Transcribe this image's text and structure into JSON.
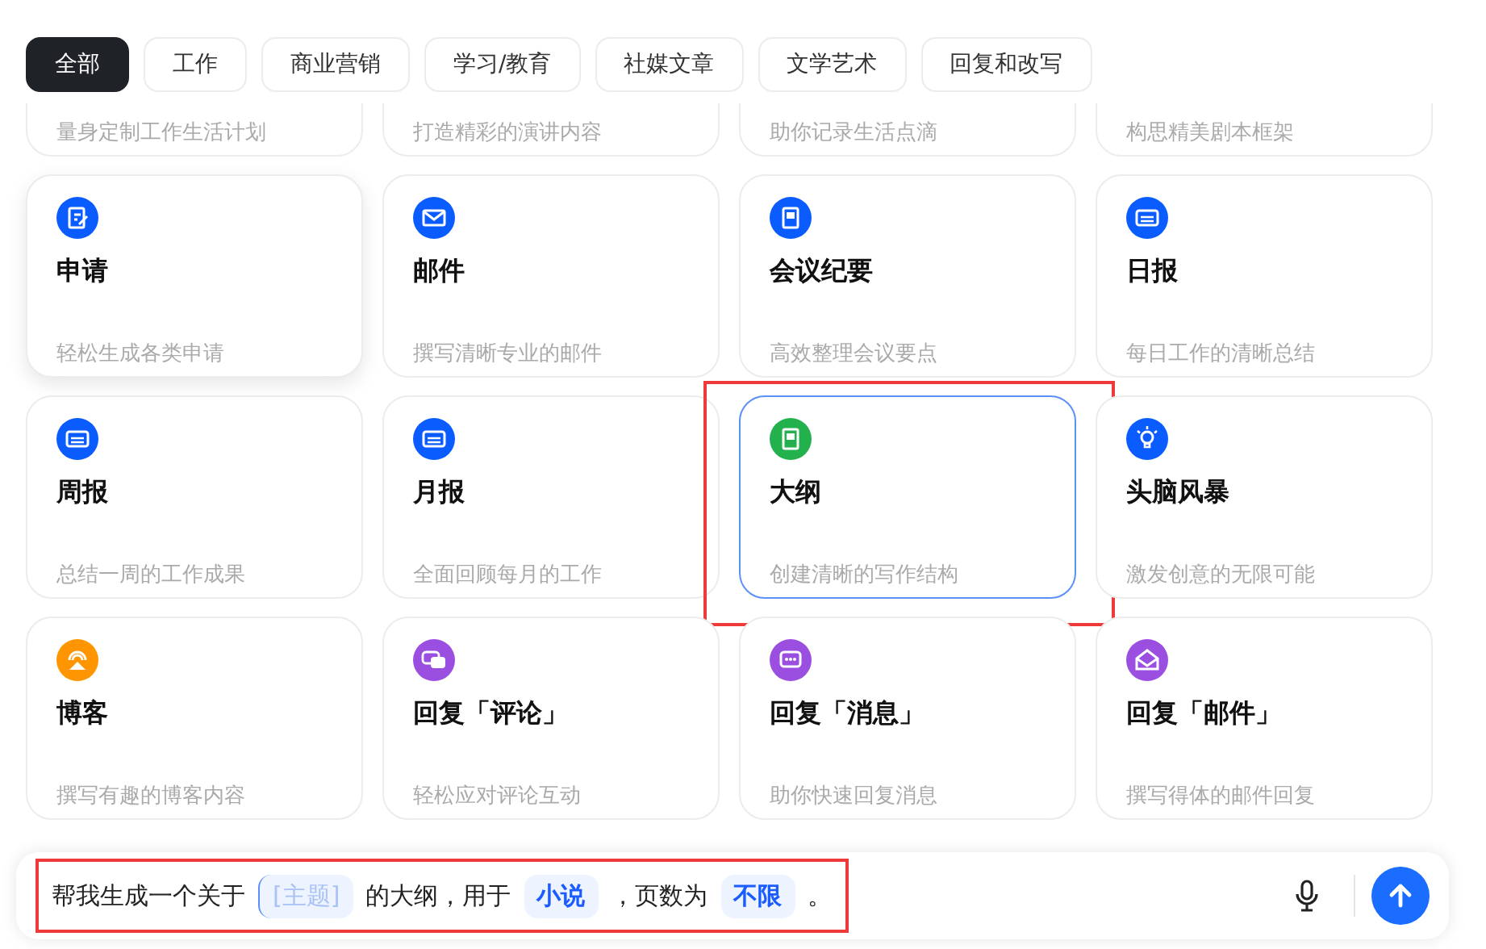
{
  "tabs": [
    {
      "label": "全部",
      "selected": true
    },
    {
      "label": "工作",
      "selected": false
    },
    {
      "label": "商业营销",
      "selected": false
    },
    {
      "label": "学习/教育",
      "selected": false
    },
    {
      "label": "社媒文章",
      "selected": false
    },
    {
      "label": "文学艺术",
      "selected": false
    },
    {
      "label": "回复和改写",
      "selected": false
    }
  ],
  "cards": [
    {
      "description": "量身定制工作生活计划",
      "selected": false,
      "hovered": false,
      "highlighted": false
    },
    {
      "description": "打造精彩的演讲内容",
      "selected": false,
      "hovered": false,
      "highlighted": false
    },
    {
      "description": "助你记录生活点滴",
      "selected": false,
      "hovered": false,
      "highlighted": false
    },
    {
      "description": "构思精美剧本框架",
      "selected": false,
      "hovered": false,
      "highlighted": false
    },
    {
      "kind": "edit",
      "color": "#0a5cff",
      "title": "申请",
      "description": "轻松生成各类申请",
      "selected": false,
      "hovered": true,
      "highlighted": false
    },
    {
      "kind": "mail",
      "color": "#0a5cff",
      "title": "邮件",
      "description": "撰写清晰专业的邮件",
      "selected": false,
      "hovered": false,
      "highlighted": false
    },
    {
      "kind": "doc",
      "color": "#0a5cff",
      "title": "会议纪要",
      "description": "高效整理会议要点",
      "selected": false,
      "hovered": false,
      "highlighted": false
    },
    {
      "kind": "board",
      "color": "#0a5cff",
      "title": "日报",
      "description": "每日工作的清晰总结",
      "selected": false,
      "hovered": false,
      "highlighted": false
    },
    {
      "kind": "board",
      "color": "#0a5cff",
      "title": "周报",
      "description": "总结一周的工作成果",
      "selected": false,
      "hovered": false,
      "highlighted": false
    },
    {
      "kind": "board",
      "color": "#0a5cff",
      "title": "月报",
      "description": "全面回顾每月的工作",
      "selected": false,
      "hovered": false,
      "highlighted": false
    },
    {
      "kind": "doc",
      "color": "#22b14c",
      "title": "大纲",
      "description": "创建清晰的写作结构",
      "selected": true,
      "hovered": false,
      "highlighted": true
    },
    {
      "kind": "bulb",
      "color": "#0a5cff",
      "title": "头脑风暴",
      "description": "激发创意的无限可能",
      "selected": false,
      "hovered": false,
      "highlighted": false
    },
    {
      "kind": "broadcast",
      "color": "#ff9500",
      "title": "博客",
      "description": "撰写有趣的博客内容",
      "selected": false,
      "hovered": false,
      "highlighted": false
    },
    {
      "kind": "chats",
      "color": "#9b4fe0",
      "title": "回复「评论」",
      "description": "轻松应对评论互动",
      "selected": false,
      "hovered": false,
      "highlighted": false
    },
    {
      "kind": "chat",
      "color": "#9b4fe0",
      "title": "回复「消息」",
      "description": "助你快速回复消息",
      "selected": false,
      "hovered": false,
      "highlighted": false
    },
    {
      "kind": "openmail",
      "color": "#9b4fe0",
      "title": "回复「邮件」",
      "description": "撰写得体的邮件回复",
      "selected": false,
      "hovered": false,
      "highlighted": false
    }
  ],
  "prompt": {
    "highlighted": true,
    "segments": [
      {
        "kind": "text",
        "text": "帮我生成一个关于"
      },
      {
        "kind": "placeholder",
        "text": "[主题]"
      },
      {
        "kind": "text",
        "text": "的大纲，用于"
      },
      {
        "kind": "value",
        "text": "小说"
      },
      {
        "kind": "text",
        "text": "，页数为"
      },
      {
        "kind": "value",
        "text": "不限"
      },
      {
        "kind": "text",
        "text": "。"
      }
    ]
  }
}
